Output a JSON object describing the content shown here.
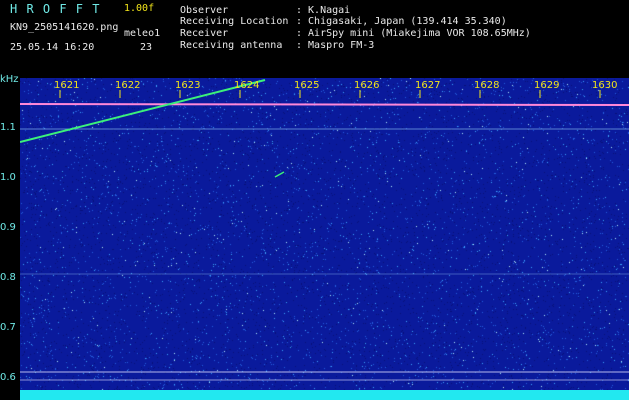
{
  "header": {
    "logo": "H R O F F T",
    "version": "1.00f",
    "filename": "KN9_2505141620.png",
    "station_label": "meleo1",
    "datetime": "25.05.14 16:20",
    "count": "23",
    "fields": [
      {
        "label": "Observer",
        "value": ": K.Nagai"
      },
      {
        "label": "Receiving Location",
        "value": ": Chigasaki, Japan (139.414 35.340)"
      },
      {
        "label": "Receiver",
        "value": ": AirSpy mini (Miakejima VOR 108.65MHz)"
      },
      {
        "label": "Receiving antenna",
        "value": ": Maspro FM-3"
      }
    ]
  },
  "yaxis": {
    "unit": "kHz",
    "ticks": [
      "1.1",
      "1.0",
      "0.9",
      "0.8",
      "0.7",
      "0.6"
    ]
  },
  "xaxis": {
    "minutes": [
      "1621",
      "1622",
      "1623",
      "1624",
      "1625",
      "1626",
      "1627",
      "1628",
      "1629",
      "1630"
    ]
  },
  "colors": {
    "background_noise": "#0a1a9c",
    "text_cyan": "#6fe9e6",
    "text_yellow": "#f2e51a",
    "carrier_line": "#ff88d8",
    "meteor_trace": "#3cf07a",
    "bottom_band": "#22e8f0"
  }
}
